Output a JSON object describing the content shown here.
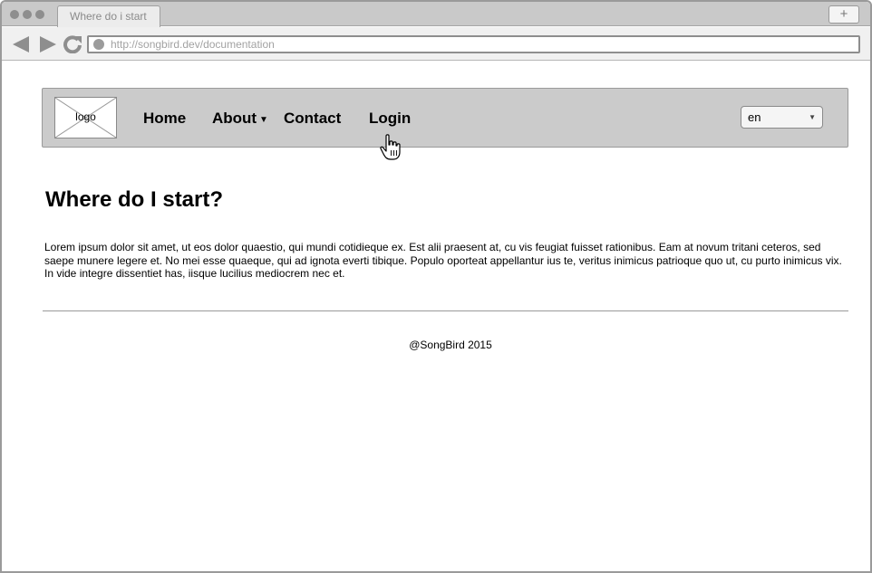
{
  "browser": {
    "tab_title": "Where do i start",
    "new_tab_label": "+",
    "url": "http://songbird.dev/documentation"
  },
  "navbar": {
    "logo_text": "logo",
    "items": [
      {
        "label": "Home"
      },
      {
        "label": "About"
      },
      {
        "label": "Contact"
      },
      {
        "label": "Login"
      }
    ],
    "language": "en"
  },
  "content": {
    "title": "Where do I start?",
    "paragraph": "Lorem ipsum dolor sit amet, ut eos dolor quaestio, qui mundi cotidieque ex. Est alii praesent at, cu vis feugiat fuisset rationibus. Eam at novum tritani ceteros, sed saepe munere legere et. No mei esse quaeque, qui ad ignota everti tibique. Populo oporteat appellantur ius te, veritus inimicus patrioque quo ut, cu purto inimicus vix. In vide integre dissentiet has, iisque lucilius mediocrem nec et."
  },
  "footer": {
    "text": "@SongBird 2015"
  }
}
